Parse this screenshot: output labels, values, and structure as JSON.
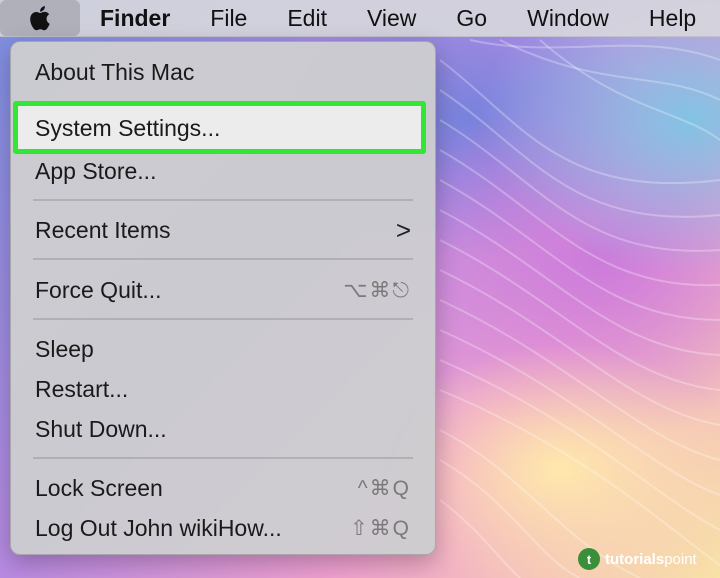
{
  "menubar": {
    "apple_icon": "apple-logo-icon",
    "items": [
      "Finder",
      "File",
      "Edit",
      "View",
      "Go",
      "Window",
      "Help"
    ]
  },
  "apple_menu": {
    "items": [
      {
        "label": "About This Mac",
        "shortcut": ""
      },
      {
        "label": "System Settings...",
        "shortcut": "",
        "highlighted": true
      },
      {
        "label": "App Store...",
        "shortcut": ""
      },
      {
        "label": "Recent Items",
        "shortcut": "",
        "submenu": true
      },
      {
        "label": "Force Quit...",
        "shortcut": "⌥⌘⎋"
      },
      {
        "label": "Sleep",
        "shortcut": ""
      },
      {
        "label": "Restart...",
        "shortcut": ""
      },
      {
        "label": "Shut Down...",
        "shortcut": ""
      },
      {
        "label": "Lock Screen",
        "shortcut": "^⌘Q"
      },
      {
        "label": "Log Out John wikiHow...",
        "shortcut": "⇧⌘Q"
      }
    ],
    "submenu_chevron": ">"
  },
  "watermark": {
    "brand_a": "tutorials",
    "brand_b": "point"
  },
  "colors": {
    "highlight_border": "#33e633",
    "menubar": "#d6d6dc",
    "menu": "#cdcdd0"
  }
}
